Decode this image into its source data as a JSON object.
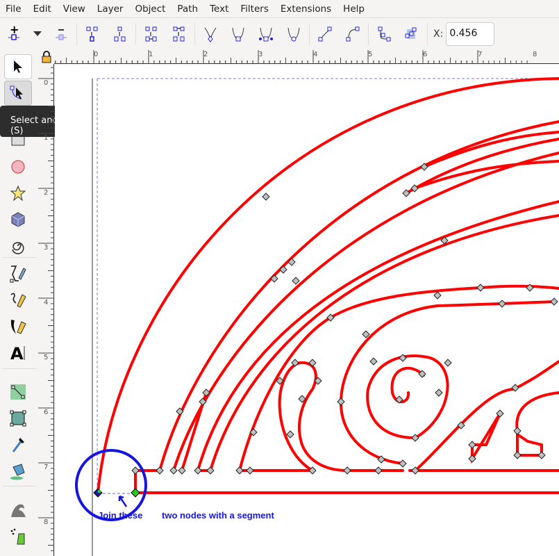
{
  "menu": [
    "File",
    "Edit",
    "View",
    "Layer",
    "Object",
    "Path",
    "Text",
    "Filters",
    "Extensions",
    "Help"
  ],
  "toolbar": {
    "buttons": [
      "insert-node",
      "insert-node-dropdown",
      "delete-node",
      "join-nodes",
      "break-path",
      "join-segment",
      "delete-segment",
      "make-cusp",
      "make-smooth",
      "make-symmetric",
      "make-auto-smooth",
      "make-line",
      "make-curve",
      "object-to-path",
      "stroke-to-path"
    ],
    "x_label": "X:",
    "x_value": "0.456"
  },
  "ruler": {
    "h_labels": [
      "0",
      "1",
      "2",
      "3",
      "4",
      "5",
      "6",
      "7",
      "8"
    ],
    "v_labels": [
      "0",
      "1",
      "2",
      "3",
      "4",
      "5",
      "6",
      "7",
      "8"
    ]
  },
  "tools": [
    "selector",
    "node",
    "rectangle",
    "circle",
    "star",
    "3d-box",
    "spiral",
    "pen",
    "pencil",
    "calligraphy",
    "text",
    "gradient",
    "mesh",
    "dropper",
    "paint-bucket",
    "tweak",
    "spray"
  ],
  "tooltip": "Select and transform objects (S)",
  "annotation": {
    "label1": "Join these",
    "label2": "two nodes with a segment",
    "color": "#1515e0"
  },
  "colors": {
    "path": "#ff0000",
    "node": "#c0c0c0",
    "selected_node": "#22cc22"
  }
}
